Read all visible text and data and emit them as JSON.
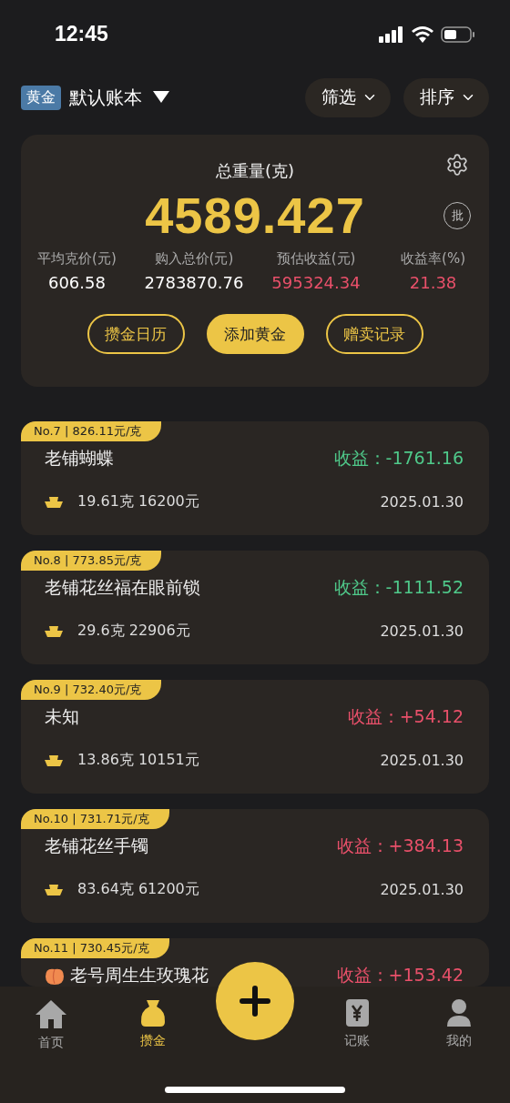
{
  "status_bar": {
    "time": "12:45"
  },
  "header": {
    "tag": "黄金",
    "book": "默认账本",
    "filter": "筛选",
    "sort": "排序"
  },
  "summary": {
    "title": "总重量(克)",
    "total": "4589.427",
    "batch_label": "批",
    "stats": [
      {
        "label": "平均克价(元)",
        "value": "606.58",
        "highlight": false
      },
      {
        "label": "购入总价(元)",
        "value": "2783870.76",
        "highlight": false
      },
      {
        "label": "预估收益(元)",
        "value": "595324.34",
        "highlight": true
      },
      {
        "label": "收益率(%)",
        "value": "21.38",
        "highlight": true
      }
    ],
    "actions": [
      {
        "label": "攒金日历",
        "kind": "outline"
      },
      {
        "label": "添加黄金",
        "kind": "filled"
      },
      {
        "label": "赠卖记录",
        "kind": "outline"
      }
    ]
  },
  "items": [
    {
      "tag": "No.7 | 826.11元/克",
      "name": "老铺蝴蝶",
      "profit": "收益：-1761.16",
      "gain": false,
      "detail": "19.61克 16200元",
      "date": "2025.01.30"
    },
    {
      "tag": "No.8 | 773.85元/克",
      "name": "老铺花丝福在眼前锁",
      "profit": "收益：-1111.52",
      "gain": false,
      "detail": "29.6克 22906元",
      "date": "2025.01.30"
    },
    {
      "tag": "No.9 | 732.40元/克",
      "name": "未知",
      "profit": "收益：+54.12",
      "gain": true,
      "detail": "13.86克 10151元",
      "date": "2025.01.30"
    },
    {
      "tag": "No.10 | 731.71元/克",
      "name": "老铺花丝手镯",
      "profit": "收益：+384.13",
      "gain": true,
      "detail": "83.64克 61200元",
      "date": "2025.01.30"
    },
    {
      "tag": "No.11 | 730.45元/克",
      "name": "老号周生生玫瑰花",
      "profit": "收益：+153.42",
      "gain": true,
      "emoji": true
    }
  ],
  "tabs": [
    {
      "label": "首页",
      "kind": "home",
      "selected": false
    },
    {
      "label": "攒金",
      "kind": "bag",
      "selected": true
    },
    {
      "label": "记账",
      "kind": "ledger",
      "selected": false
    },
    {
      "label": "我的",
      "kind": "user",
      "selected": false
    }
  ]
}
